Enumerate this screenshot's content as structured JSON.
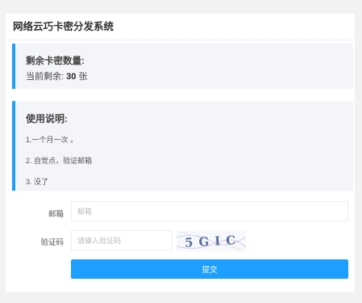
{
  "header": {
    "title": "网络云巧卡密分发系统"
  },
  "stock": {
    "title": "剩余卡密数量:",
    "remaining_label": "当前剩余:",
    "remaining_value": "30",
    "remaining_unit": "张"
  },
  "help": {
    "title": "使用说明:",
    "items": [
      "1.一个月一次 。",
      "2. 自觉点，验证邮箱",
      "3. 没了"
    ]
  },
  "form": {
    "email_label": "邮箱",
    "email_placeholder": "邮箱",
    "captcha_label": "验证码",
    "captcha_placeholder": "请输入验证码",
    "captcha_text": "5GIC",
    "submit_label": "提交"
  },
  "colors": {
    "accent": "#1e9fff",
    "block_bg": "#f3f5f8"
  }
}
